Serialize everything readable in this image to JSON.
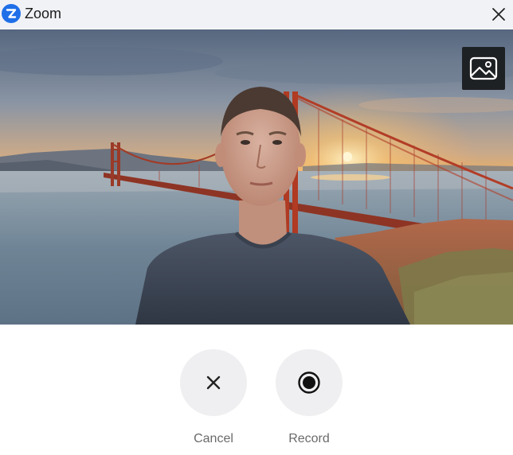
{
  "window": {
    "app_name": "Zoom",
    "logo_icon": "zoom-logo-icon",
    "close_icon": "close-icon"
  },
  "preview": {
    "background_button_icon": "image-icon",
    "scene": "virtual background of bridge at sunset with person in foreground"
  },
  "controls": {
    "cancel_label": "Cancel",
    "cancel_icon": "close-icon",
    "record_label": "Record",
    "record_icon": "record-icon"
  },
  "colors": {
    "accent": "#1f6fe8",
    "titlebar_bg": "#f1f2f6",
    "button_bg": "#efeff1",
    "label_text": "#6a6a6a"
  }
}
